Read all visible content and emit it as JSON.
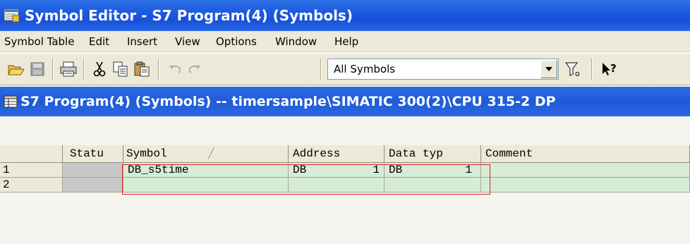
{
  "window": {
    "title": "Symbol Editor - S7 Program(4) (Symbols)"
  },
  "menu": [
    "Symbol Table",
    "Edit",
    "Insert",
    "View",
    "Options",
    "Window",
    "Help"
  ],
  "toolbar": {
    "filter_value": "All Symbols",
    "buttons": [
      "open-icon",
      "save-icon",
      "print-icon",
      "cut-icon",
      "copy-icon",
      "paste-icon",
      "undo-icon",
      "redo-icon",
      "filter-icon",
      "help-cursor-icon"
    ]
  },
  "document": {
    "title": "S7 Program(4) (Symbols) -- timersample\\SIMATIC 300(2)\\CPU 315-2 DP"
  },
  "table": {
    "headers": {
      "status": "Statu",
      "symbol": "Symbol",
      "address": "Address",
      "data_type": "Data typ",
      "comment": "Comment"
    },
    "rows": [
      {
        "num": "1",
        "symbol": "DB_s5time",
        "address_type": "DB",
        "address_num": "1",
        "data_type": "DB",
        "data_num": "1",
        "comment": ""
      },
      {
        "num": "2",
        "symbol": "",
        "address_type": "",
        "address_num": "",
        "data_type": "",
        "data_num": "",
        "comment": ""
      }
    ]
  },
  "colors": {
    "title_blue": "#1e5ce0",
    "grid_green": "#d6ecd6",
    "highlight_red": "#e02020"
  }
}
